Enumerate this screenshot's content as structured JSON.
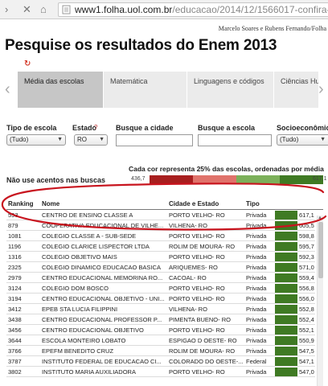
{
  "browser": {
    "url_host": "www1.folha.uol.com.br",
    "url_path": "/educacao/2014/12/1566017-confira-o-d"
  },
  "byline": "Marcelo Soares e Rubens Fernando/Folha",
  "title": "Pesquise os resultados do Enem 2013",
  "tabs": [
    {
      "label": "Média das escolas",
      "active": true
    },
    {
      "label": "Matemática",
      "active": false
    },
    {
      "label": "Linguagens e códigos",
      "active": false
    },
    {
      "label": "Ciências Hu",
      "active": false
    }
  ],
  "filters": {
    "tipo": {
      "label": "Tipo de escola",
      "value": "(Tudo)"
    },
    "estado": {
      "label": "Estado",
      "value": "RO",
      "help": "?"
    },
    "cidade": {
      "label": "Busque a cidade",
      "value": ""
    },
    "escola": {
      "label": "Busque a escola",
      "value": ""
    },
    "socio": {
      "label": "Socioeconômico",
      "value": "(Tudo)"
    }
  },
  "hint": "Não use acentos nas buscas",
  "color_scale": {
    "caption": "Cada cor representa 25% das escolas, ordenadas por média",
    "min": "436,7",
    "max": "617,1",
    "colors": [
      "#a81f1f",
      "#e0736b",
      "#7cb05a",
      "#3f7a23"
    ]
  },
  "table": {
    "headers": [
      "Ranking",
      "Nome",
      "Cidade e Estado",
      "Tipo"
    ],
    "rows": [
      {
        "rank": "593",
        "name": "CENTRO DE ENSINO CLASSE A",
        "city": "PORTO VELHO- RO",
        "type": "Privada",
        "score": "617,1"
      },
      {
        "rank": "879",
        "name": "COOPERATIVA EDUCACIONAL DE VILHE...",
        "city": "VILHENA- RO",
        "type": "Privada",
        "score": "605,5"
      },
      {
        "rank": "1081",
        "name": "COLEGIO CLASSE A - SUB-SEDE",
        "city": "PORTO VELHO- RO",
        "type": "Privada",
        "score": "598,8"
      },
      {
        "rank": "1196",
        "name": "COLEGIO CLARICE LISPECTOR LTDA",
        "city": "ROLIM DE MOURA- RO",
        "type": "Privada",
        "score": "595,7"
      },
      {
        "rank": "1316",
        "name": "COLEGIO OBJETIVO MAIS",
        "city": "PORTO VELHO- RO",
        "type": "Privada",
        "score": "592,3"
      },
      {
        "rank": "2325",
        "name": "COLEGIO DINAMICO EDUCACAO BASICA",
        "city": "ARIQUEMES- RO",
        "type": "Privada",
        "score": "571,0"
      },
      {
        "rank": "2979",
        "name": "CENTRO EDUCACIONAL MEMORINA RO...",
        "city": "CACOAL- RO",
        "type": "Privada",
        "score": "559,4"
      },
      {
        "rank": "3124",
        "name": "COLEGIO DOM BOSCO",
        "city": "PORTO VELHO- RO",
        "type": "Privada",
        "score": "556,8"
      },
      {
        "rank": "3194",
        "name": "CENTRO EDUCACIONAL OBJETIVO - UNI...",
        "city": "PORTO VELHO- RO",
        "type": "Privada",
        "score": "556,0"
      },
      {
        "rank": "3412",
        "name": "EPEB STA LUCIA FILIPPINI",
        "city": "VILHENA- RO",
        "type": "Privada",
        "score": "552,8"
      },
      {
        "rank": "3438",
        "name": "CENTRO EDUCACIONAL PROFESSOR P...",
        "city": "PIMENTA BUENO- RO",
        "type": "Privada",
        "score": "552,4"
      },
      {
        "rank": "3456",
        "name": "CENTRO EDUCACIONAL OBJETIVO",
        "city": "PORTO VELHO- RO",
        "type": "Privada",
        "score": "552,1"
      },
      {
        "rank": "3644",
        "name": "ESCOLA MONTEIRO LOBATO",
        "city": "ESPIGAO D OESTE- RO",
        "type": "Privada",
        "score": "550,9"
      },
      {
        "rank": "3766",
        "name": "EPEFM BENEDITO CRUZ",
        "city": "ROLIM DE MOURA- RO",
        "type": "Privada",
        "score": "547,5"
      },
      {
        "rank": "3787",
        "name": "INSTITUTO FEDERAL DE EDUCACAO CI...",
        "city": "COLORADO DO OESTE-...",
        "type": "Federal",
        "score": "547,1"
      },
      {
        "rank": "3802",
        "name": "INSTITUTO MARIA AUXILIADORA",
        "city": "PORTO VELHO- RO",
        "type": "Privada",
        "score": "547,0"
      }
    ]
  }
}
